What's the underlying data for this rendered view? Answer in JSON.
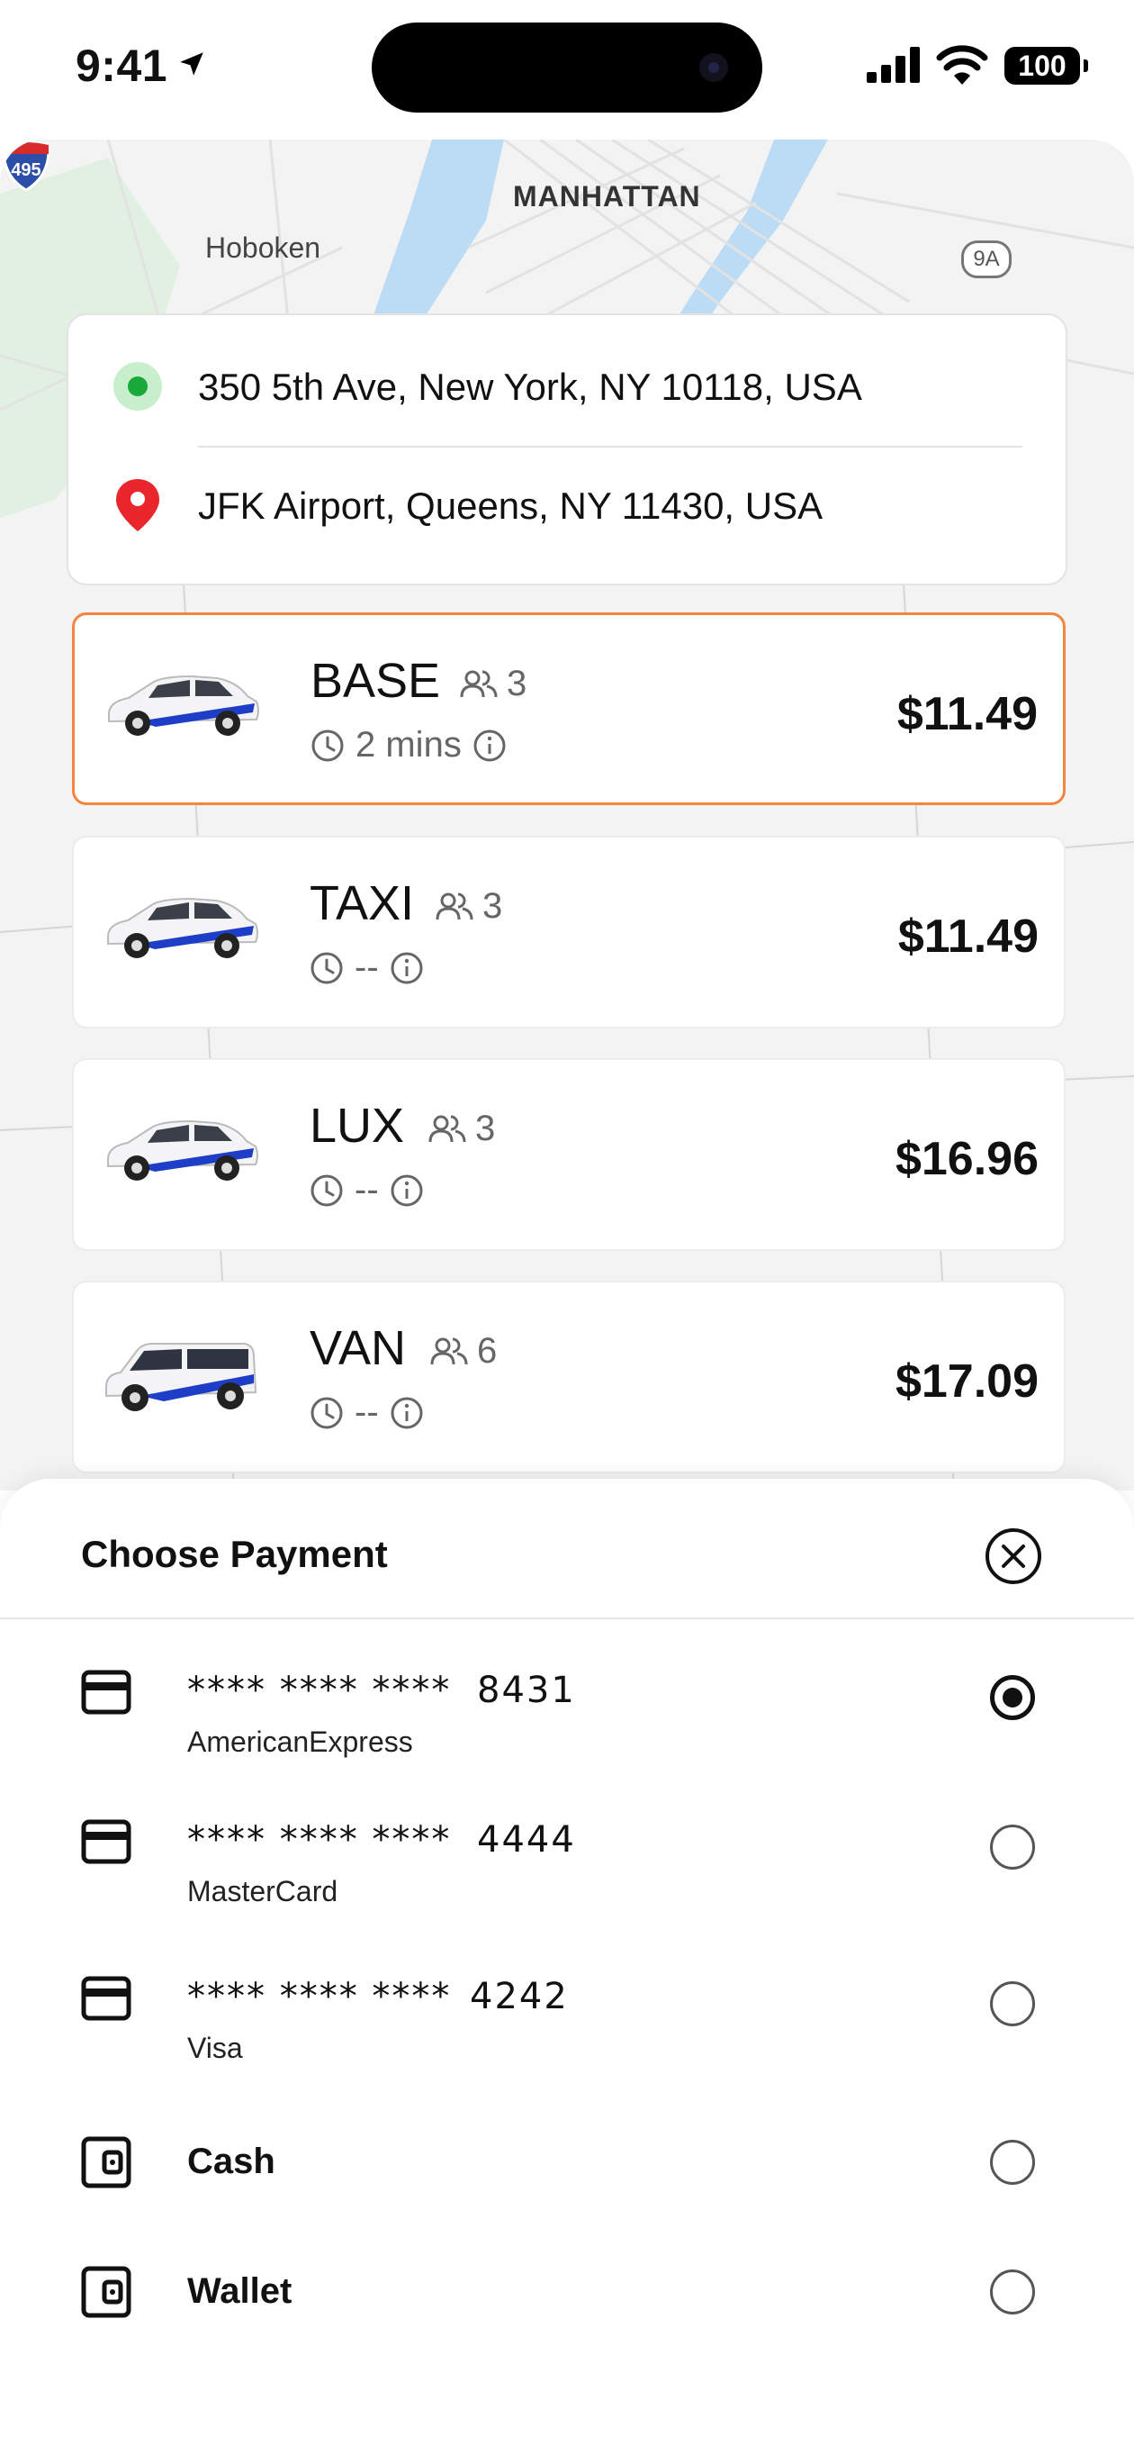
{
  "status_bar": {
    "time": "9:41",
    "battery": "100"
  },
  "map": {
    "labels": {
      "manhattan": "MANHATTAN",
      "hoboken": "Hoboken",
      "interstate": "495",
      "route": "9A"
    }
  },
  "route": {
    "pickup": "350 5th Ave, New York, NY 10118, USA",
    "dropoff": "JFK Airport, Queens, NY 11430, USA"
  },
  "rides": [
    {
      "name": "BASE",
      "seats": "3",
      "eta": "2 mins",
      "price": "$11.49",
      "selected": true
    },
    {
      "name": "TAXI",
      "seats": "3",
      "eta": "--",
      "price": "$11.49",
      "selected": false
    },
    {
      "name": "LUX",
      "seats": "3",
      "eta": "--",
      "price": "$16.96",
      "selected": false
    },
    {
      "name": "VAN",
      "seats": "6",
      "eta": "--",
      "price": "$17.09",
      "selected": false
    }
  ],
  "payment": {
    "title": "Choose Payment",
    "methods": [
      {
        "masked": "****  ****  ****",
        "last4": "8431",
        "brand": "AmericanExpress",
        "icon": "credit-card-icon",
        "selected": true
      },
      {
        "masked": "****  ****  ****",
        "last4": "4444",
        "brand": "MasterCard",
        "icon": "credit-card-icon",
        "selected": false
      },
      {
        "masked": "****  ****  ****",
        "last4": "4242",
        "brand": "Visa",
        "icon": "credit-card-icon",
        "selected": false
      },
      {
        "label": "Cash",
        "icon": "wallet-icon",
        "selected": false
      },
      {
        "label": "Wallet",
        "icon": "wallet-icon",
        "selected": false
      }
    ]
  },
  "colors": {
    "accent": "#f5843f",
    "pickup_green": "#19a83a",
    "dropoff_red": "#e8262c",
    "map_water": "#bcdcf5",
    "car_stripe": "#1f3ec8"
  }
}
